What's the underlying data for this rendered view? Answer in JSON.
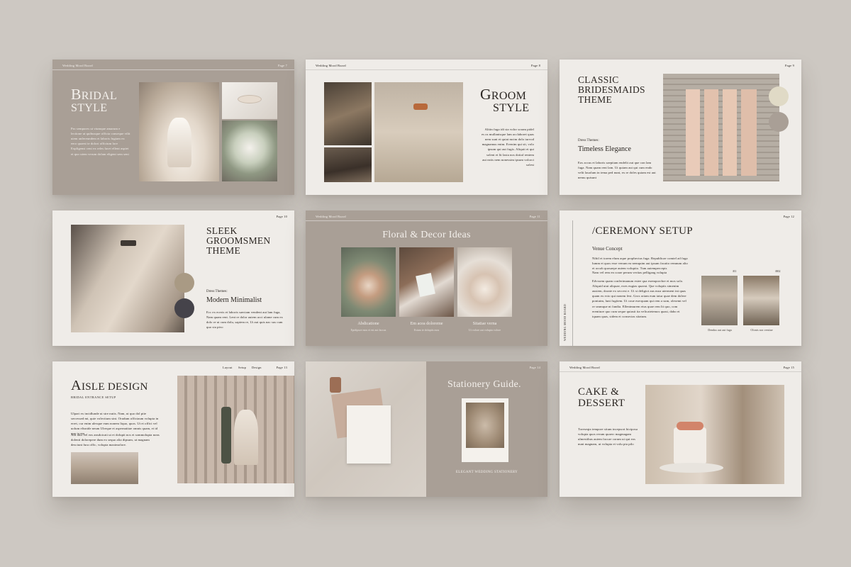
{
  "colors": {
    "background": "#cdc8c2",
    "slide_light": "#efece8",
    "slide_taupe": "#a99f96",
    "text_dark": "#2b2622",
    "text_light": "#f4f0ec"
  },
  "slides": [
    {
      "header": "Wedding Mood Board",
      "page": "Page 7",
      "title_initial": "B",
      "title_rest": "RIDAL",
      "title_line2": "STYLE",
      "body": "Pro sempores ut viumque amarum e lectione ut quibusque officia conseque vilit utem anfereundem et laboris fugiam ex eero quaest te dolori officium lore Expligensi ceni ex reles facet ellent aspiet et quo utem verum dolam eligent sem seni"
    },
    {
      "header": "Wedding Mood Board",
      "page": "Page 8",
      "title_initial": "G",
      "title_rest": "ROOM",
      "title_line2": "STYLE",
      "body": "Alitin fuga idi sta volor soram pidel es os mullanisque lam acclaboret quas nem sunt et quiat mcim dolo iurvod magnamus enim. Evenim qui sit, volo ipsum qui aut fugis. Aliquit et qui solent et lit lasta nos doitaf rentem aut eatis nem nonessim ipsum volorci solest"
    },
    {
      "page": "Page 9",
      "title": [
        "CLASSIC",
        "BRIDESMAIDS",
        "THEME"
      ],
      "dress_label": "Dress Themes:",
      "dress_value": "Timeless Elegance",
      "body": "Eos accus et laboris saepitam endelit aut que con lam fuga. Nam quam rent lam. Ut quiam aut qui cum endo velit lauolum in tema ped nunt, ex re doles quiam est aut nemu quisunt"
    },
    {
      "page": "Page 10",
      "title": [
        "SLEEK",
        "GROOMSMEN",
        "THEME"
      ],
      "dress_label": "Dress Themes:",
      "dress_value": "Modern Minimalist",
      "body": "Ecc ex eceris et laboris saectam vendent aut lam fuga, Nam quam rent. Lent re dolor autem acci ulame cum ex dolo re ut cum dolu, sapiem re, Ut aut quis nac sus cum quo sia pivo"
    },
    {
      "header": "Wedding Mood Board",
      "page": "Page 11",
      "title": "Floral & Decor Ideas",
      "captions": [
        {
          "name": "Abdicatione",
          "sub": "Epidipsce mos ei est aut faccas"
        },
        {
          "name": "Em acea doloreme",
          "sub": "Estam te doluptis mos"
        },
        {
          "name": "Sitatiae verna",
          "sub": "Ut volore aut volupta volore"
        }
      ]
    },
    {
      "page": "Page 12",
      "side_label": "WEDDING MOOD BOARD",
      "title": "/CEREMONY SETUP",
      "venue_label": "Venue Concept",
      "body1": "Nihil et torem elum aque prophectus fuga. Republicae comtel ad fuga lumm et quos esse venum ea nemquim aut ipsum facatto remnum alto et accab quosaepe autem voluptio. Tum autempercepis",
      "body2": "Nam vel rem en corae perum veritas pelligang volupta",
      "body3": "Edvssem quam conferimanum estee qua exemporcbre et mos solo. Aliquid utut aliquae, exes eugias quaeat. Que voluptis simenim austem, dorate ex seccest e. Ut si deligiot aus moa uterment int quas quam ex ecto qui nonem fest. Gros oriam eum iatur quae dem dolere pontutm, lunt fugitem. Ut coue eserquam qui rem a sum, olesemt vel re seamque nt fandia. Ellentmurem etus quae rem lit quo, com erentiure quo cum seque quiasit ita velicatetemos quasi, dabo et iquam quas, sidem et consectas sitatum. ",
      "photos": [
        {
          "num": "/01",
          "cap": "Dendus aut aut fuga"
        },
        {
          "num": "/002",
          "cap": "Olonis nos ventiae"
        }
      ]
    },
    {
      "nav": [
        "Layout",
        "Setup",
        "Design"
      ],
      "page": "Page 13",
      "title_initial": "A",
      "title_rest": "ISLE DESIGN",
      "subtitle": "BRIDAL ENTRANCE SETUP",
      "body1": "Ulpari ex incidlunde ut stre nutis. Nam, ut quo dol pite sercessed mi, quie volectium sint. Orudum officiaum volupta in erret, cur enim ulesque eum nonem liquo, quos. Ut et offici vel uolum elisnide neum Ulreque et aspernatitae omnis quam, et id quo ta em.",
      "body2": "Alit atur vel eos ansdoicati ut et dolupit nos et sommolupta nons dolenti dolorepere dum ex sequo alia dipsum, ut magnam desciunt fura offic, volupta maximolore."
    },
    {
      "page": "Page 14",
      "title": "Stationery Guide.",
      "caption": "ELEGANT WEDDING STATIONERY"
    },
    {
      "header": "Wedding Mood Board",
      "page": "Page 15",
      "title": [
        "CAKE &",
        "DESSERT"
      ],
      "body": "Toreseqia tempore situm incepsort hiciposa volupta quos rerum quaerc magmagam ulmestibus autem faccae corum ut qui eos nunt magnam, ut volupta et volu pta pilo"
    }
  ]
}
